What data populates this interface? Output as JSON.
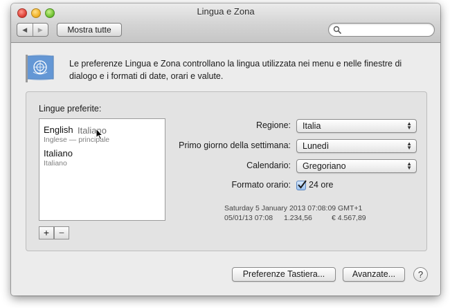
{
  "window": {
    "title": "Lingua e Zona"
  },
  "toolbar": {
    "back_glyph": "◀",
    "forward_glyph": "▶",
    "show_all_label": "Mostra tutte",
    "search_placeholder": ""
  },
  "header": {
    "icon": "un-flag-icon",
    "description": "Le preferenze Lingua e Zona controllano la lingua utilizzata nei menu e nelle finestre di dialogo e i formati di date, orari e valute."
  },
  "languages": {
    "title": "Lingue preferite:",
    "items": [
      {
        "name": "English",
        "subtitle": "Inglese — principale"
      },
      {
        "name": "Italiano",
        "subtitle": "Italiano"
      }
    ],
    "drag_label": "Italiano",
    "add_label": "+",
    "remove_label": "−"
  },
  "settings": {
    "region": {
      "label": "Regione:",
      "value": "Italia"
    },
    "first_day": {
      "label": "Primo giorno della settimana:",
      "value": "Lunedì"
    },
    "calendar": {
      "label": "Calendario:",
      "value": "Gregoriano"
    },
    "time_format": {
      "label": "Formato orario:",
      "checkbox_label": "24 ore",
      "checked": true
    }
  },
  "sample": {
    "line1": "Saturday 5 January 2013 07:08:09 GMT+1",
    "line2_date": "05/01/13 07:08",
    "line2_number": "1.234,56",
    "line2_currency": "€ 4.567,89"
  },
  "footer": {
    "keyboard_label": "Preferenze Tastiera...",
    "advanced_label": "Avanzate...",
    "help_label": "?"
  },
  "colors": {
    "accent": "#4a7fc1",
    "window_bg": "#ececec"
  }
}
